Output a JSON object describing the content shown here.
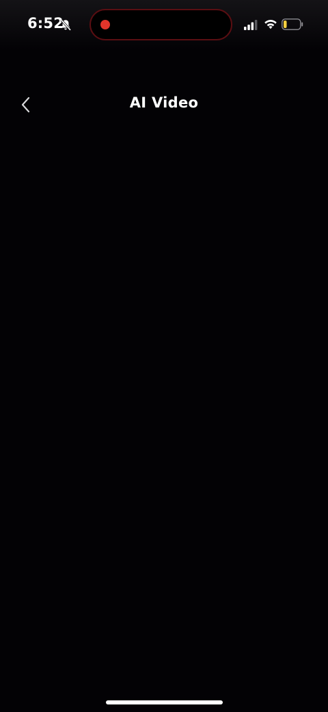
{
  "status_bar": {
    "time": "6:52",
    "icons": {
      "silent": "bell-slash-icon",
      "recording": "record-dot-icon",
      "signal": "cellular-signal-icon",
      "wifi": "wifi-icon",
      "battery": "battery-low-icon"
    },
    "colors": {
      "recording_dot": "#e0352b",
      "island_border": "#5a0e12",
      "battery_fill": "#f4d03f"
    },
    "battery_level": 0.2
  },
  "header": {
    "back_icon": "chevron-left-icon",
    "title": "AI Video"
  },
  "theme": {
    "background": "#030205",
    "text": "#ffffff"
  }
}
